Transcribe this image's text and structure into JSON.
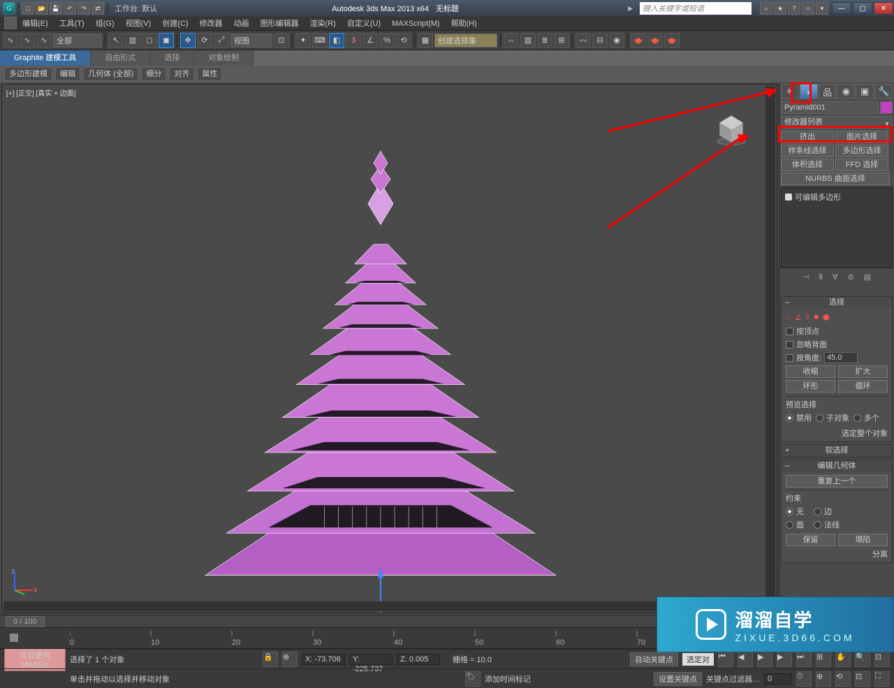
{
  "title": {
    "app": "Autodesk 3ds Max  2013 x64",
    "doc": "无标题"
  },
  "workspace": {
    "label": "工作台: 默认"
  },
  "search": {
    "placeholder": "键入关键字或短语"
  },
  "menus": [
    "编辑(E)",
    "工具(T)",
    "组(G)",
    "视图(V)",
    "创建(C)",
    "修改器",
    "动画",
    "图形编辑器",
    "渲染(R)",
    "自定义(U)",
    "MAXScript(M)",
    "帮助(H)"
  ],
  "toolbar": {
    "filter": "全部",
    "view_drop": "视图",
    "create_set": "创建选择集"
  },
  "ribbon": {
    "tabs": [
      "Graphite 建模工具",
      "自由形式",
      "选择",
      "对象绘制"
    ],
    "bar": [
      "多边形建模",
      "编辑",
      "几何体 (全部)",
      "细分",
      "对齐",
      "属性"
    ]
  },
  "viewport": {
    "label": "[+] [正交] [真实 + 边面]"
  },
  "panel": {
    "object_name": "Pyramid001",
    "modifier_list": "修改器列表",
    "mods": [
      "挤出",
      "面片选择",
      "样条线选择",
      "多边形选择",
      "体积选择",
      "FFD 选择",
      "NURBS 曲面选择"
    ],
    "stack_item": "可编辑多边形",
    "rollout_sel": "选择",
    "by_vertex": "按顶点",
    "ignore_backface": "忽略背面",
    "by_angle": "按角度:",
    "angle_val": "45.0",
    "shrink": "收缩",
    "grow": "扩大",
    "ring": "环形",
    "loop": "循环",
    "preview": "预览选择",
    "preview_opts": [
      "禁用",
      "子对象",
      "多个"
    ],
    "sel_whole": "选定整个对象",
    "soft_sel": "软选择",
    "edit_geom": "编辑几何体",
    "repeat_last": "重复上一个",
    "constraint": "约束",
    "constraints": [
      "无",
      "边",
      "面",
      "法线"
    ],
    "preserve": "保留",
    "collapse": "塌陷",
    "separate": "分离"
  },
  "timeline": {
    "frame": "0 / 100"
  },
  "status": {
    "welcome": "欢迎使用",
    "maxscript": "MAXSci",
    "sel_count": "选择了 1 个对象",
    "hint": "单击并拖动以选择并移动对象",
    "x": "X: -73.706",
    "y": "Y: -225.737",
    "z": "Z: 0.005",
    "grid": "栅格 = 10.0",
    "add_marker": "添加时间标记",
    "auto_key": "自动关键点",
    "set_key": "设置关键点",
    "sel_match": "选定对",
    "key_filter": "关键点过滤器…"
  },
  "brand": {
    "name": "溜溜自学",
    "url": "ZIXUE.3D66.COM"
  }
}
